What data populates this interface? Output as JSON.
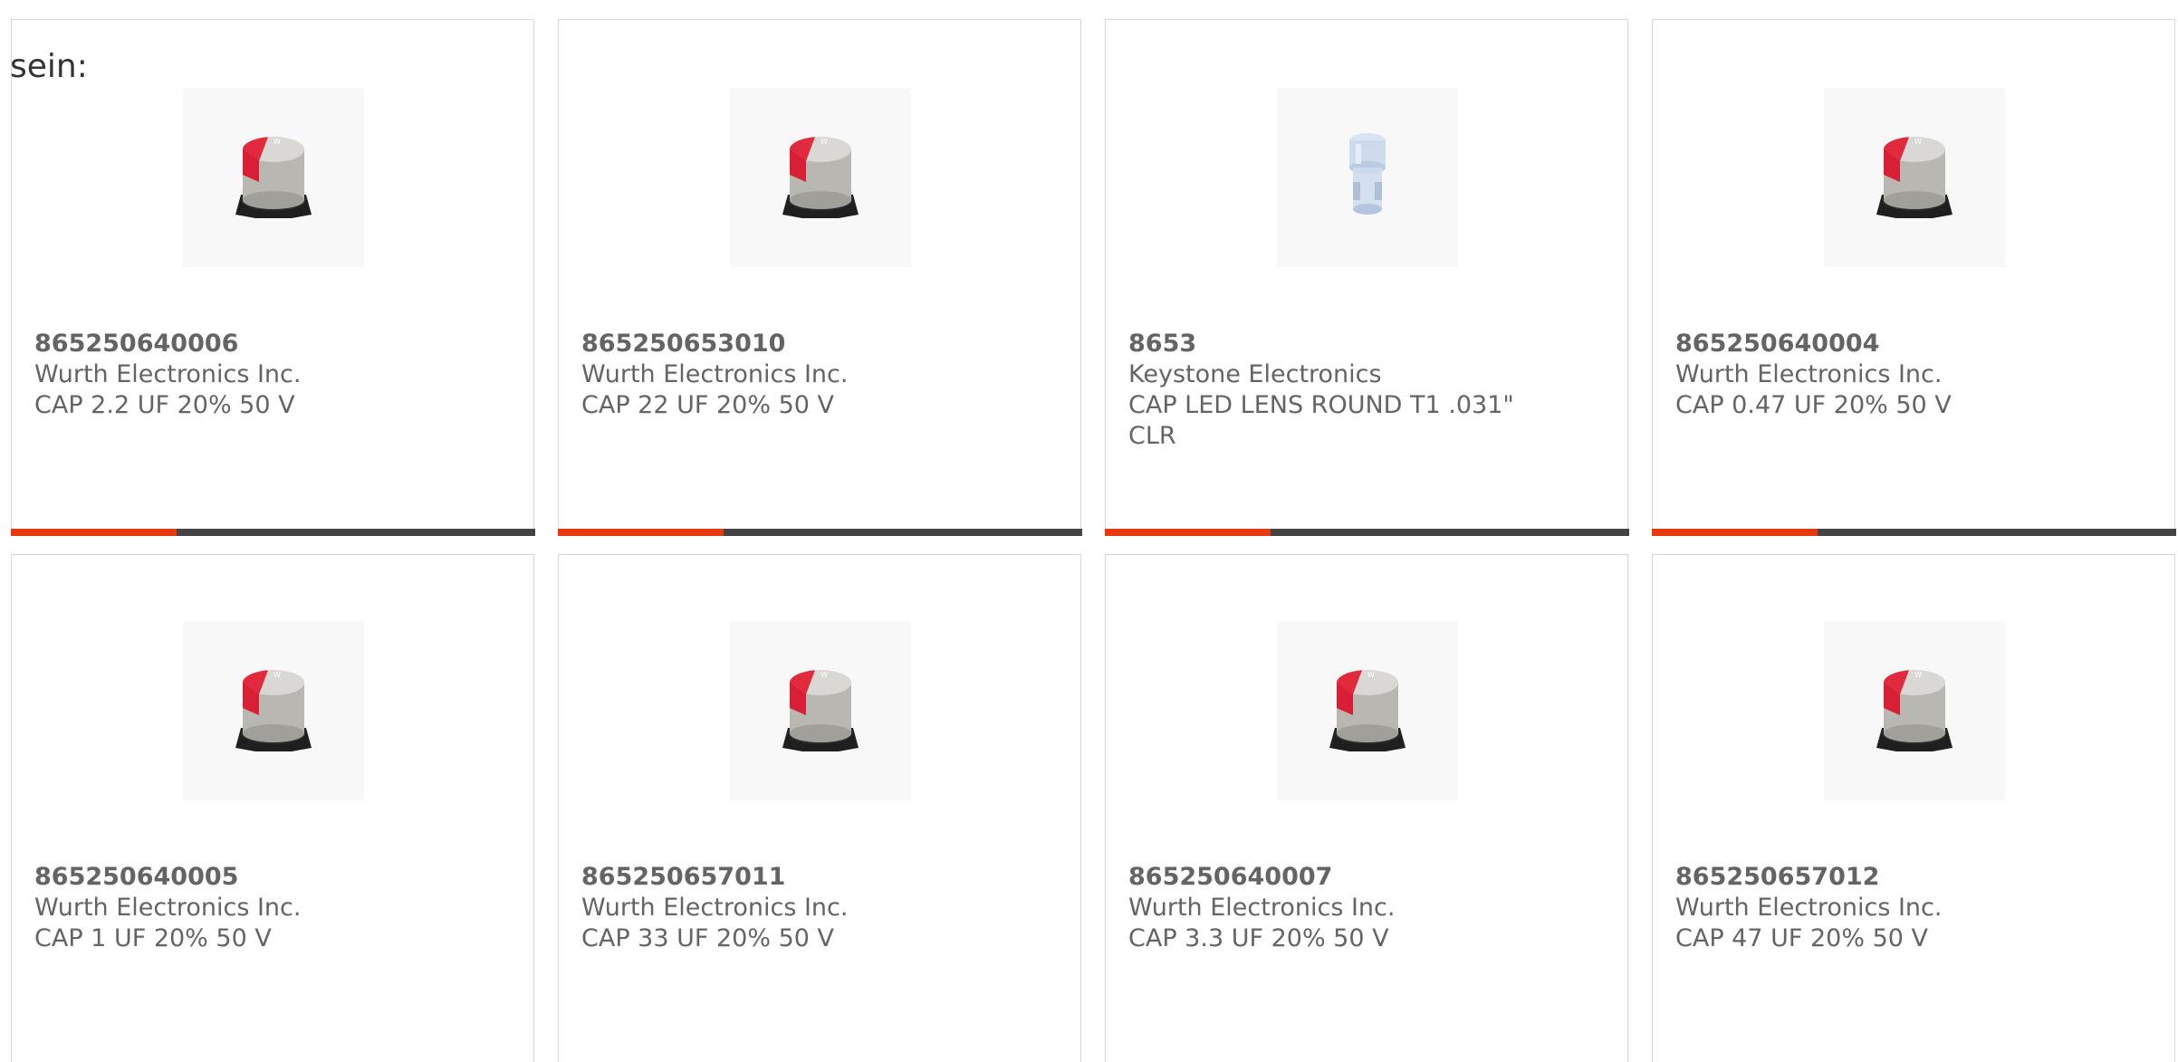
{
  "intro_text": "sein:",
  "colors": {
    "accent": "#e8380d",
    "bar": "#434343",
    "text": "#646464",
    "border": "#d6d6d6"
  },
  "products": [
    {
      "part_number": "865250640006",
      "manufacturer": "Wurth Electronics Inc.",
      "description": "CAP 2.2 UF 20% 50 V",
      "image_icon": "capacitor-icon"
    },
    {
      "part_number": "865250653010",
      "manufacturer": "Wurth Electronics Inc.",
      "description": "CAP 22 UF 20% 50 V",
      "image_icon": "capacitor-icon"
    },
    {
      "part_number": "8653",
      "manufacturer": "Keystone Electronics",
      "description": "CAP LED LENS ROUND T1 .031\" CLR",
      "image_icon": "led-lens-icon"
    },
    {
      "part_number": "865250640004",
      "manufacturer": "Wurth Electronics Inc.",
      "description": "CAP 0.47 UF 20% 50 V",
      "image_icon": "capacitor-icon"
    },
    {
      "part_number": "865250640005",
      "manufacturer": "Wurth Electronics Inc.",
      "description": "CAP 1 UF 20% 50 V",
      "image_icon": "capacitor-icon"
    },
    {
      "part_number": "865250657011",
      "manufacturer": "Wurth Electronics Inc.",
      "description": "CAP 33 UF 20% 50 V",
      "image_icon": "capacitor-icon"
    },
    {
      "part_number": "865250640007",
      "manufacturer": "Wurth Electronics Inc.",
      "description": "CAP 3.3 UF 20% 50 V",
      "image_icon": "capacitor-icon"
    },
    {
      "part_number": "865250657012",
      "manufacturer": "Wurth Electronics Inc.",
      "description": "CAP 47 UF 20% 50 V",
      "image_icon": "capacitor-icon"
    }
  ]
}
